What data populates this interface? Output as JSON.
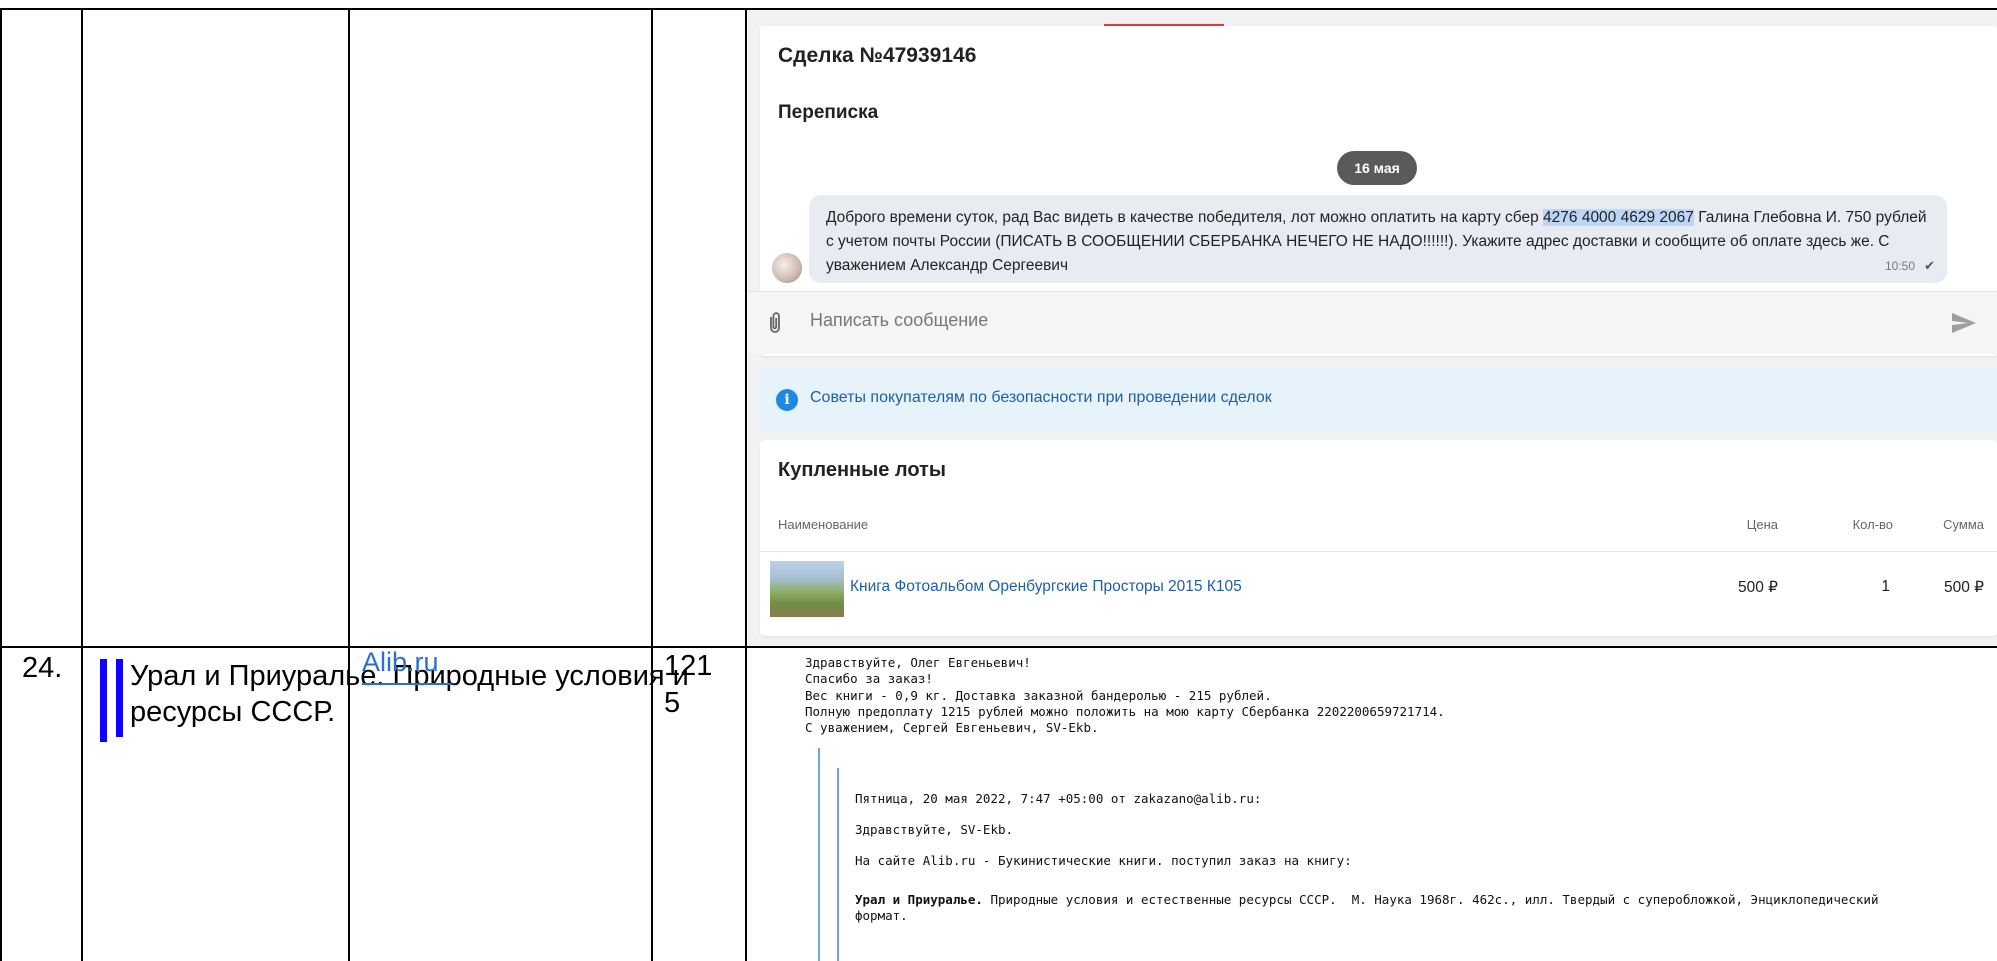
{
  "deal": {
    "title": "Сделка №47939146",
    "correspondence_title": "Переписка",
    "date_badge": "16 мая",
    "message": {
      "text_before": "Доброго времени суток, рад Вас видеть в качестве победителя, лот можно оплатить на карту сбер ",
      "highlight": "4276 4000 4629 2067",
      "text_after": " Галина Глебовна И. 750 рублей с учетом почты России (ПИСАТЬ В СООБЩЕНИИ СБЕРБАНКА НЕЧЕГО НЕ НАДО!!!!!!). Укажите адрес доставки и сообщите об оплате здесь же. С уважением Александр Сергеевич",
      "time": "10:50"
    },
    "input_placeholder": "Написать сообщение",
    "safety_tips": "Советы покупателям по безопасности при проведении сделок",
    "purchased": {
      "title": "Купленные лоты",
      "columns": [
        "Наименование",
        "Цена",
        "Кол-во",
        "Сумма"
      ],
      "rows": [
        {
          "name": "Книга Фотоальбом Оренбургские Просторы 2015 К105",
          "price": "500 ₽",
          "qty": "1",
          "sum": "500 ₽"
        }
      ]
    }
  },
  "table_row": {
    "number": "24.",
    "title": "Урал и Приуралье. Природные условия и естественные ресурсы СССР.",
    "title_line1": "Урал и Приуралье. Природные условия и",
    "title_line2": "ресурсы СССР.",
    "source_link": "Alib.ru",
    "price_line1": "121",
    "price_line2": "5"
  },
  "email": {
    "lines": [
      "Здравствуйте, Олег Евгеньевич!",
      "Спасибо за заказ!",
      "Вес книги - 0,9 кг. Доставка заказной бандеролью - 215 рублей.",
      "Полную предоплату 1215 рублей можно положить на мою карту Сбербанка 2202200659721714.",
      "С уважением, Сергей Евгеньевич, SV-Ekb."
    ],
    "quoted": {
      "header": "Пятница, 20 мая 2022, 7:47 +05:00 от zakazano@alib.ru:",
      "greeting": "Здравствуйте, SV-Ekb.",
      "intro": "На сайте Alib.ru - Букинистические книги. поступил заказ на книгу:",
      "book_bold": "Урал и Приуралье.",
      "book_rest": " Природные условия и естественные ресурсы СССР.  М. Наука 1968г. 462с., илл. Твердый с суперобложкой, Энциклопедический",
      "book_line2": "формат."
    }
  }
}
